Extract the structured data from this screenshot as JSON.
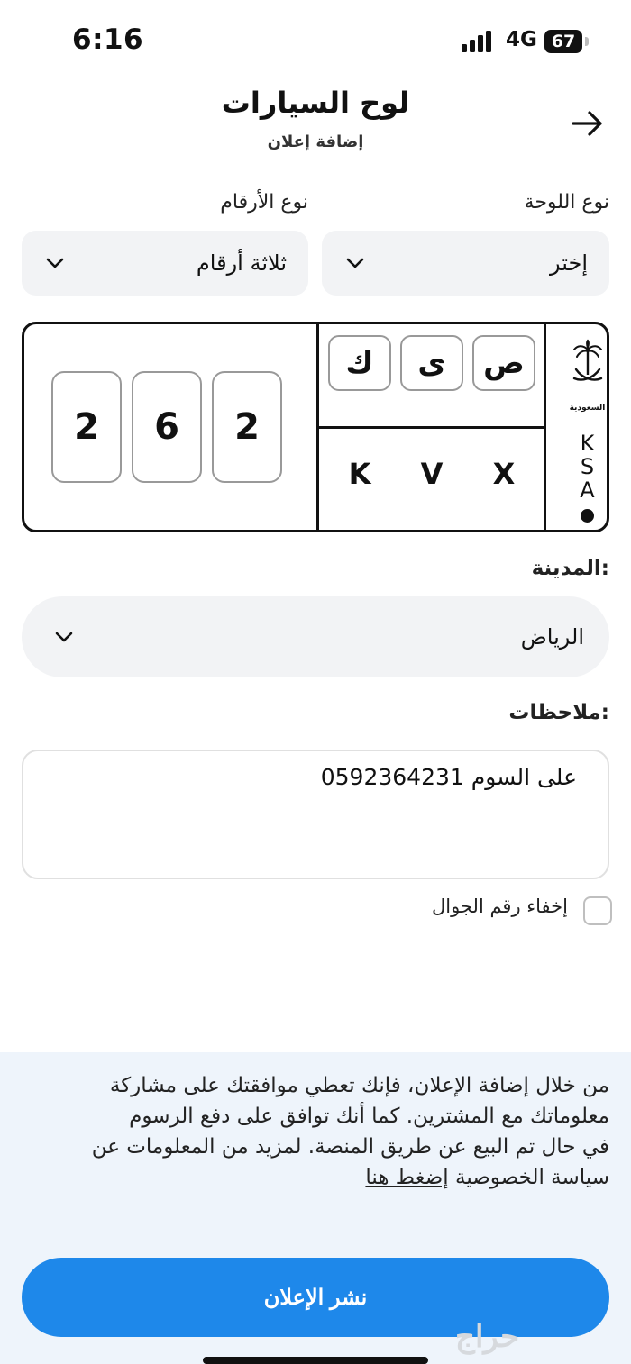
{
  "status": {
    "time": "6:16",
    "network": "4G",
    "battery": "67"
  },
  "header": {
    "title": "لوح السيارات",
    "subtitle": "إضافة إعلان"
  },
  "form": {
    "plate_type_label": "نوع اللوحة",
    "plate_type_value": "إختر",
    "digits_type_label": "نوع الأرقام",
    "digits_type_value": "ثلاثة أرقام",
    "city_label": "المدينة:",
    "city_value": "الرياض",
    "notes_label": "ملاحظات:",
    "notes_value": "على السوم 0592364231",
    "hide_phone_label": "إخفاء رقم الجوال"
  },
  "plate": {
    "digits": [
      "2",
      "6",
      "2"
    ],
    "arabic_letters": [
      "ك",
      "ى",
      "ص"
    ],
    "latin_letters": [
      "K",
      "V",
      "X"
    ],
    "country_word": "السعودية",
    "country_code": [
      "K",
      "S",
      "A"
    ]
  },
  "footer": {
    "disclaimer_line1": "من خلال إضافة الإعلان، فإنك تعطي موافقتك على مشاركة",
    "disclaimer_line2": "معلوماتك مع المشترين. كما أنك توافق على دفع الرسوم",
    "disclaimer_line3": "في حال تم البيع عن طريق المنصة. لمزيد من المعلومات عن",
    "disclaimer_line4": "سياسة الخصوصية",
    "disclaimer_link": "إضغط هنا",
    "publish_label": "نشر الإعلان",
    "brand": "حراج"
  },
  "colors": {
    "accent": "#1e88ea",
    "panel": "#eef4fb",
    "field": "#f2f3f5"
  }
}
